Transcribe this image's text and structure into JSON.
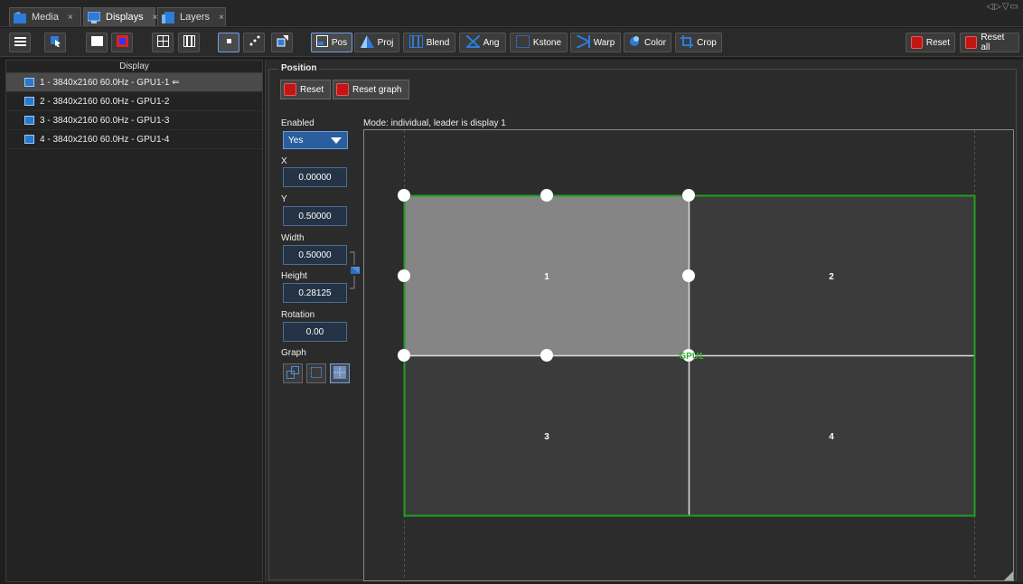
{
  "tabs": [
    {
      "label": "Media",
      "icon": "media-icon",
      "active": false
    },
    {
      "label": "Displays",
      "icon": "displays-icon",
      "active": true
    },
    {
      "label": "Layers",
      "icon": "layers-icon",
      "active": false
    }
  ],
  "tab_close": "×",
  "window_controls": "◁▷▽▭",
  "toolbar": {
    "pos_label": "Pos",
    "proj_label": "Proj",
    "blend_label": "Blend",
    "ang_label": "Ang",
    "kstone_label": "Kstone",
    "warp_label": "Warp",
    "color_label": "Color",
    "crop_label": "Crop",
    "reset_label": "Reset",
    "reset_all_label": "Reset all"
  },
  "display_list": {
    "header": "Display",
    "items": [
      {
        "label": "1 - 3840x2160 60.0Hz - GPU1-1 ⇐",
        "selected": true
      },
      {
        "label": "2 - 3840x2160 60.0Hz - GPU1-2",
        "selected": false
      },
      {
        "label": "3 - 3840x2160 60.0Hz - GPU1-3",
        "selected": false
      },
      {
        "label": "4 - 3840x2160 60.0Hz - GPU1-4",
        "selected": false
      }
    ]
  },
  "position": {
    "title": "Position",
    "reset_label": "Reset",
    "reset_graph_label": "Reset graph",
    "enabled_label": "Enabled",
    "enabled_value": "Yes",
    "x_label": "X",
    "x_value": "0.00000",
    "y_label": "Y",
    "y_value": "0.50000",
    "width_label": "Width",
    "width_value": "0.50000",
    "height_label": "Height",
    "height_value": "0.28125",
    "rotation_label": "Rotation",
    "rotation_value": "0.00",
    "graph_label": "Graph",
    "mode_text": "Mode: individual, leader is display 1"
  },
  "canvas": {
    "quadrants": [
      "1",
      "2",
      "3",
      "4"
    ],
    "gpu_label": "GPU1"
  },
  "colors": {
    "accent_blue": "#2d7bd8",
    "reset_red": "#c21515",
    "border_green": "#1fa01f",
    "selected_display_fill": "#858585"
  }
}
